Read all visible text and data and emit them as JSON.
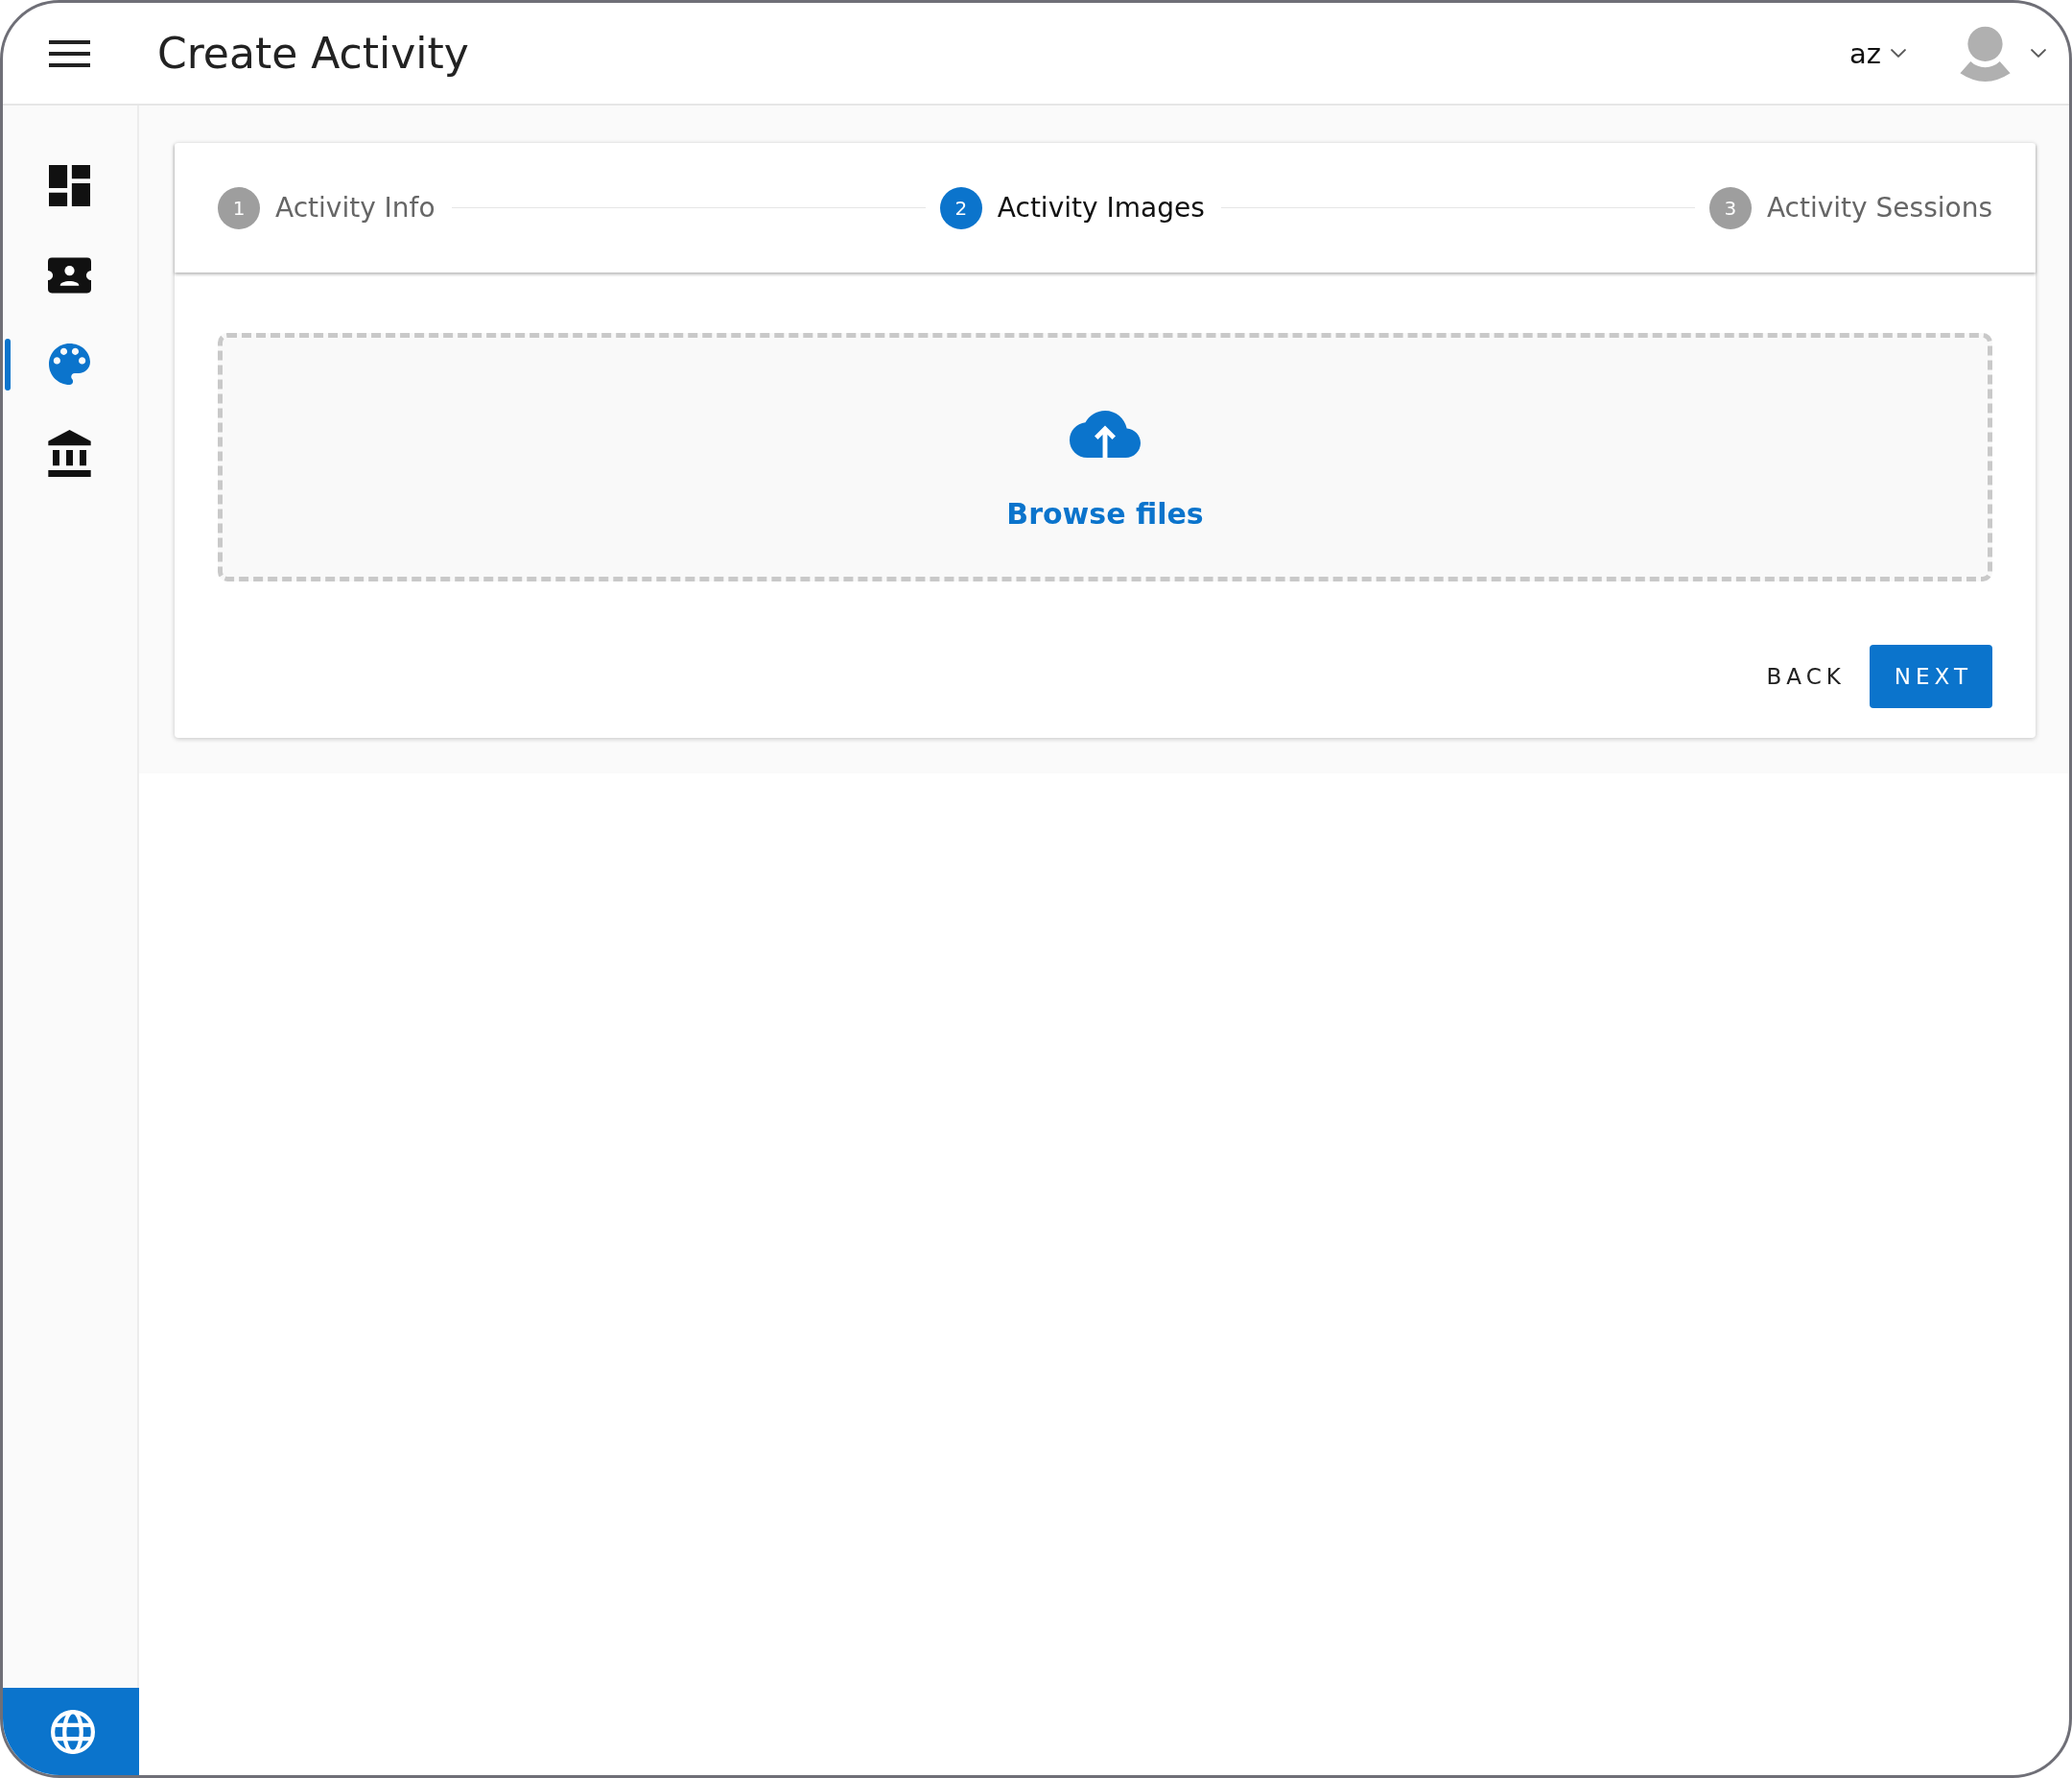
{
  "header": {
    "title": "Create Activity",
    "language": "az"
  },
  "sidebar": {
    "items": [
      {
        "selected": false
      },
      {
        "selected": false
      },
      {
        "selected": true
      },
      {
        "selected": false
      }
    ]
  },
  "stepper": {
    "steps": [
      {
        "number": "1",
        "label": "Activity Info",
        "selected": false
      },
      {
        "number": "2",
        "label": "Activity Images",
        "selected": true
      },
      {
        "number": "3",
        "label": "Activity Sessions",
        "selected": false
      }
    ]
  },
  "upload": {
    "link": "Browse files"
  },
  "buttons": [
    {
      "label": "BACK",
      "kind": "text"
    },
    {
      "label": "NEXT",
      "kind": "primary"
    }
  ]
}
